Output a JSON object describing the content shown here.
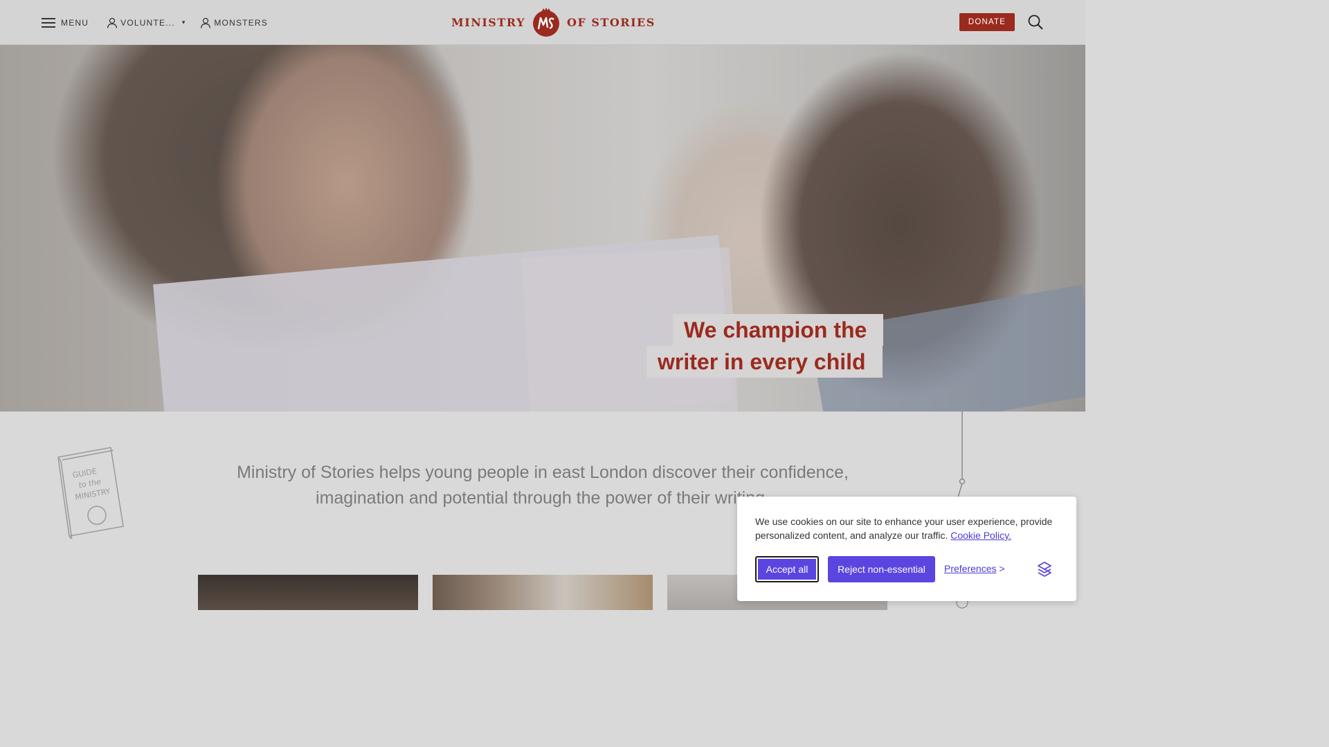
{
  "header": {
    "menu_label": "MENU",
    "volunteers_label": "VOLUNTE...",
    "caret": "▾",
    "monsters_label": "MONSTERS",
    "logo_left": "MINISTRY",
    "logo_right": "OF STORIES",
    "donate_label": "DONATE"
  },
  "hero": {
    "tagline_line1": "We champion the",
    "tagline_line2": "writer in every child"
  },
  "main": {
    "intro": "Ministry of Stories helps young people in east London discover their confidence, imagination and potential through the power of their writing."
  },
  "cookie_banner": {
    "text": "We use cookies on our site to enhance your user experience, provide personalized content, and analyze our traffic.",
    "policy_link": "Cookie Policy.",
    "accept_label": "Accept all",
    "reject_label": "Reject non-essential",
    "preferences_label": "Preferences",
    "preferences_arrow": ">"
  },
  "colors": {
    "brand_red": "#9b2a1e",
    "cookie_button": "#5b45e0",
    "header_bg": "#d4d4d4"
  },
  "icons": [
    "hamburger-icon",
    "user-icon",
    "search-icon",
    "guide-book-icon",
    "cookie-brand-icon"
  ]
}
